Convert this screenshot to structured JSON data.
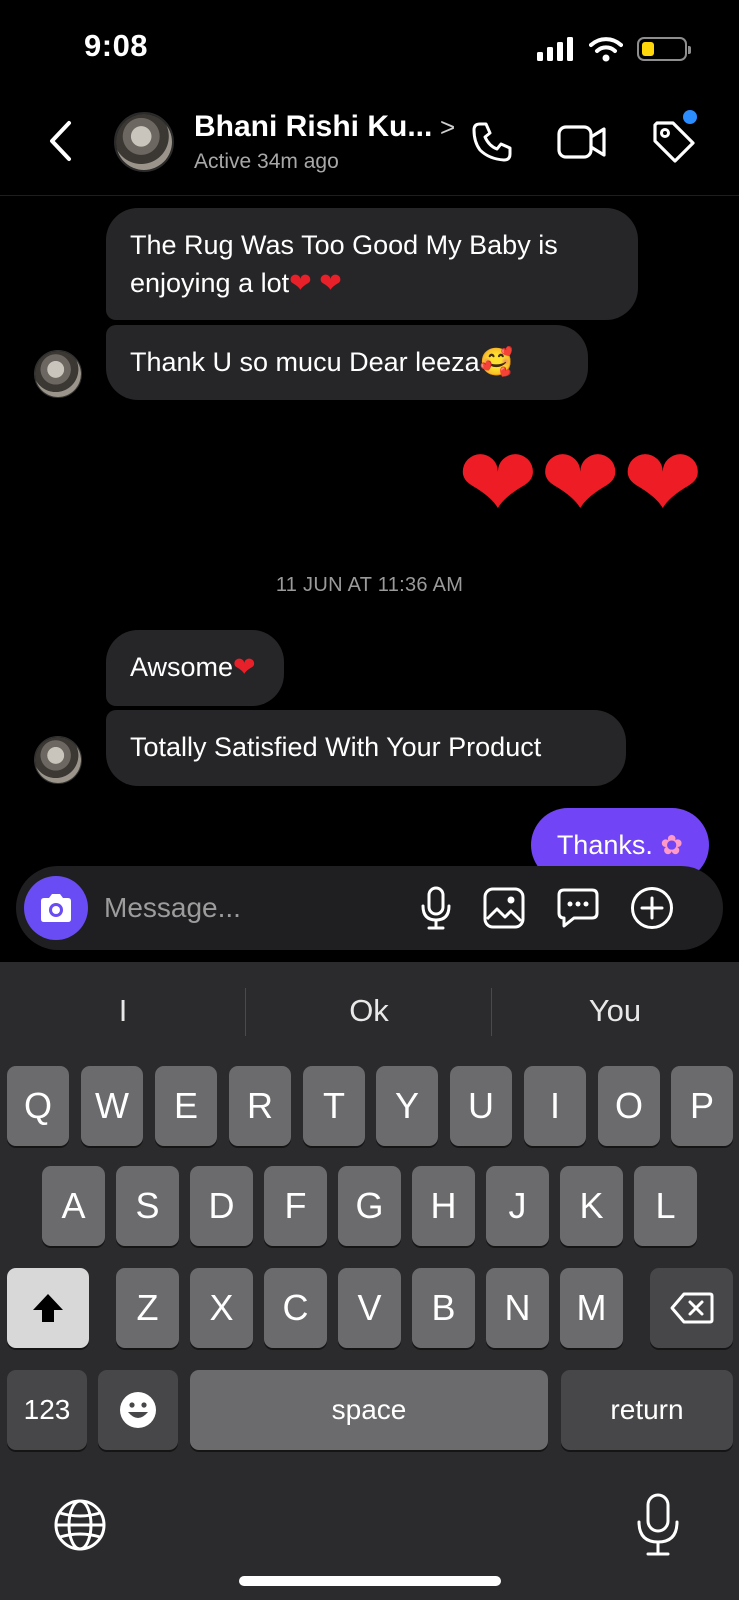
{
  "status_bar": {
    "time": "9:08"
  },
  "header": {
    "contact_name": "Bhani Rishi Ku...",
    "status": "Active 34m ago"
  },
  "messages": {
    "m1": "The Rug Was Too Good My Baby is enjoying a lot",
    "m2": "Thank U so mucu Dear leeza",
    "hearts": "❤❤❤",
    "timestamp": "11 JUN AT 11:36 AM",
    "m3": "Awsome",
    "m4": "Totally Satisfied With Your Product",
    "sent": "Thanks."
  },
  "composer": {
    "placeholder": "Message..."
  },
  "keyboard": {
    "suggestions": [
      "I",
      "Ok",
      "You"
    ],
    "row1": [
      "Q",
      "W",
      "E",
      "R",
      "T",
      "Y",
      "U",
      "I",
      "O",
      "P"
    ],
    "row2": [
      "A",
      "S",
      "D",
      "F",
      "G",
      "H",
      "J",
      "K",
      "L"
    ],
    "row3": [
      "Z",
      "X",
      "C",
      "V",
      "B",
      "N",
      "M"
    ],
    "numbers_key": "123",
    "space_key": "space",
    "return_key": "return"
  },
  "colors": {
    "sent_bubble": "#7145f5",
    "received_bubble": "#262628",
    "camera_button": "#6a4cf4",
    "notification_dot": "#2c8dff"
  },
  "icons": [
    "back-icon",
    "phone-icon",
    "video-icon",
    "tag-icon",
    "camera-icon",
    "microphone-icon",
    "gallery-icon",
    "sticker-icon",
    "plus-icon",
    "shift-icon",
    "delete-icon",
    "emoji-icon",
    "globe-icon",
    "dictation-icon"
  ]
}
